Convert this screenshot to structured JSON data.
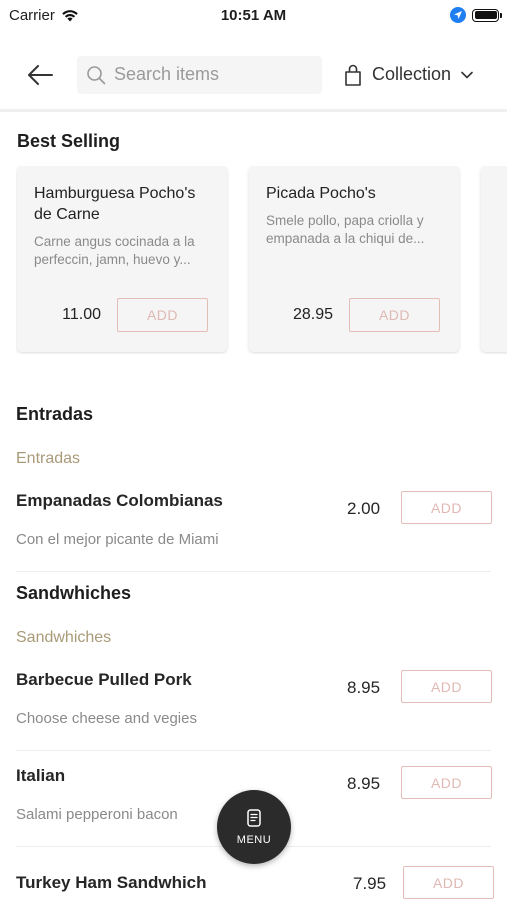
{
  "status_bar": {
    "carrier": "Carrier",
    "time": "10:51 AM"
  },
  "header": {
    "search_placeholder": "Search items",
    "collection_label": "Collection"
  },
  "best_selling": {
    "title": "Best Selling",
    "cards": [
      {
        "name": "Hamburguesa Pocho's de Carne",
        "description": "Carne angus cocinada a la perfeccin, jamn, huevo y...",
        "price": "11.00",
        "add_label": "ADD"
      },
      {
        "name": "Picada Pocho's",
        "description": "Smele pollo, papa criolla y empanada a la chiqui de...",
        "price": "28.95",
        "add_label": "ADD"
      }
    ]
  },
  "categories": [
    {
      "title": "Entradas",
      "subtitle": "Entradas",
      "items": [
        {
          "name": "Empanadas Colombianas",
          "description": "Con el mejor picante de Miami",
          "price": "2.00",
          "add_label": "ADD"
        }
      ]
    },
    {
      "title": "Sandwhiches",
      "subtitle": "Sandwhiches",
      "items": [
        {
          "name": "Barbecue Pulled Pork",
          "description": "Choose cheese and vegies",
          "price": "8.95",
          "add_label": "ADD"
        },
        {
          "name": "Italian",
          "description": "Salami pepperoni bacon",
          "price": "8.95",
          "add_label": "ADD"
        },
        {
          "name": "Turkey Ham Sandwhich",
          "description": "",
          "price": "7.95",
          "add_label": "ADD"
        }
      ]
    }
  ],
  "fab": {
    "label": "MENU",
    "icon": "menu-document-icon"
  },
  "colors": {
    "accent_gold": "#a99a78",
    "add_border": "#e5bdb8",
    "fab_bg": "#2b2b2b"
  }
}
